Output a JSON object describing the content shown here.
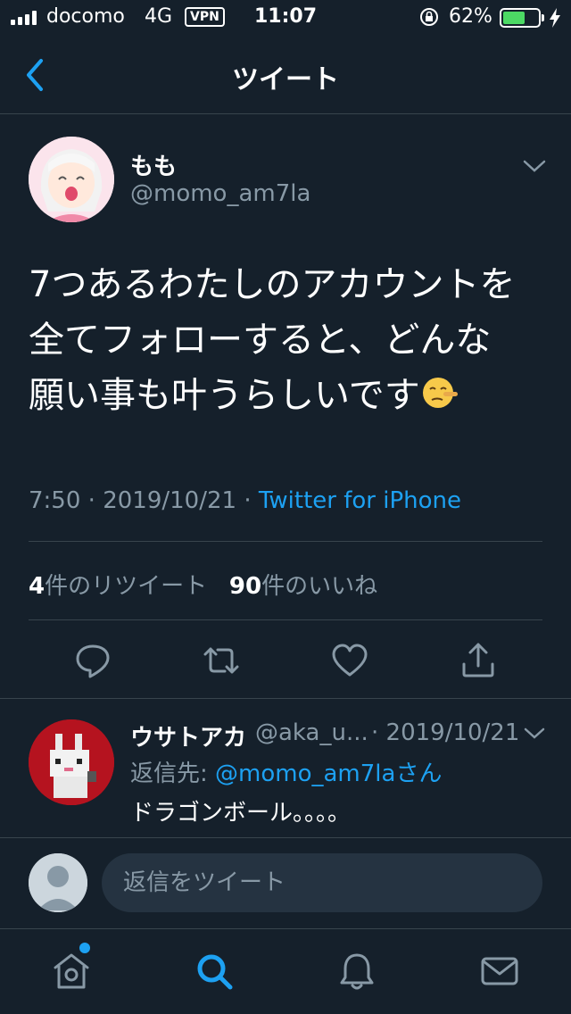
{
  "status_bar": {
    "carrier": "docomo",
    "network": "4G",
    "vpn": "VPN",
    "time": "11:07",
    "battery_percent": "62%",
    "battery_level": 0.62
  },
  "header": {
    "title": "ツイート"
  },
  "tweet": {
    "display_name": "もも",
    "handle": "@momo_am7la",
    "text_line1": "7つあるわたしのアカウントを",
    "text_line2": "全てフォローすると、どんな",
    "text_line3": "願い事も叶うらしいです",
    "emoji_icon": "lying-face-icon",
    "time": "7:50",
    "date": "2019/10/21",
    "separator": "·",
    "source": "Twitter for iPhone",
    "retweet_count": "4",
    "retweet_label": "件のリツイート",
    "like_count": "90",
    "like_label": "件のいいね"
  },
  "actions": {
    "icons": [
      "reply-icon",
      "retweet-icon",
      "like-icon",
      "share-icon"
    ]
  },
  "reply": {
    "display_name": "ウサトアカ",
    "handle": "@aka_u...",
    "date": "· 2019/10/21",
    "replying_to_label": "返信先: ",
    "replying_to_handle": "@momo_am7laさん",
    "text": "ドラゴンボール。。。。"
  },
  "compose": {
    "placeholder": "返信をツイート"
  },
  "tab_bar": {
    "icons": [
      "home-icon",
      "search-icon",
      "notifications-icon",
      "messages-icon"
    ]
  },
  "colors": {
    "background": "#15202b",
    "accent": "#1da1f2",
    "secondary_text": "#8899a6",
    "divider": "#38444d",
    "battery": "#4cd964"
  }
}
